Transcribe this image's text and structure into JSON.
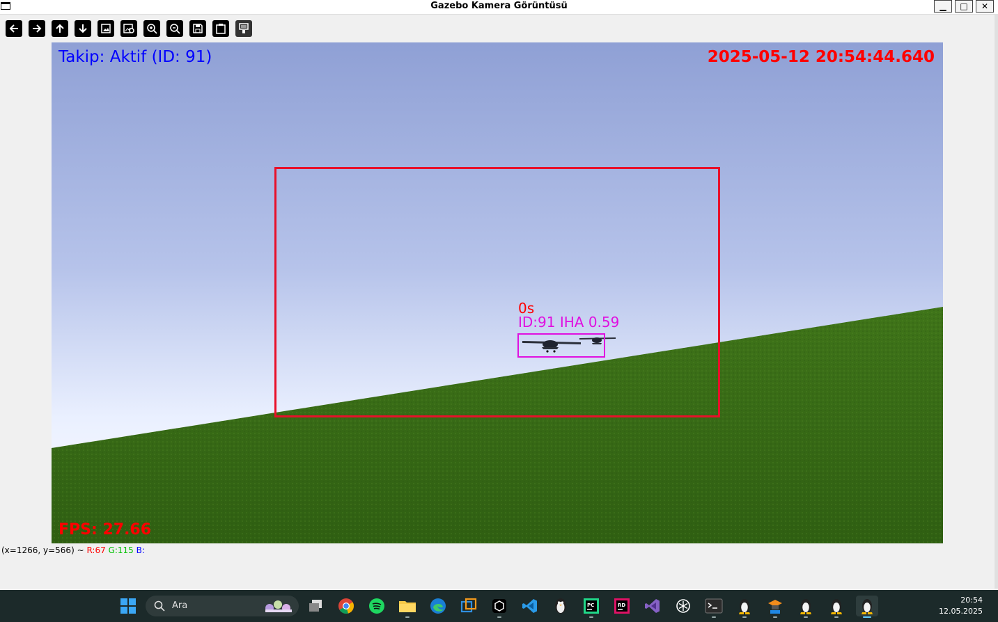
{
  "window": {
    "title": "Gazebo Kamera Görüntüsü"
  },
  "toolbar": {
    "buttons": [
      {
        "name": "pan-left-button",
        "icon": "arrow-left-icon"
      },
      {
        "name": "pan-right-button",
        "icon": "arrow-right-icon"
      },
      {
        "name": "pan-up-button",
        "icon": "arrow-up-icon"
      },
      {
        "name": "pan-down-button",
        "icon": "arrow-down-icon"
      },
      {
        "name": "zoom-fit-button",
        "icon": "image-icon"
      },
      {
        "name": "zoom-original-button",
        "icon": "image-zoom-icon"
      },
      {
        "name": "zoom-in-button",
        "icon": "zoom-in-icon"
      },
      {
        "name": "zoom-out-button",
        "icon": "zoom-out-icon"
      },
      {
        "name": "save-button",
        "icon": "save-icon"
      },
      {
        "name": "copy-button",
        "icon": "clipboard-icon"
      },
      {
        "name": "properties-button",
        "icon": "properties-icon"
      }
    ]
  },
  "overlay": {
    "tracking_status": "Takip: Aktif (ID: 91)",
    "timestamp": "2025-05-12 20:54:44.640",
    "fps": "FPS: 27.66",
    "detection_time": "0s",
    "detection_label": "ID:91 IHA 0.59"
  },
  "statusline": {
    "coords": "(x=1266, y=566) ~",
    "r": "R:67",
    "g": "G:115",
    "b": "B:"
  },
  "taskbar": {
    "search_placeholder": "Ara",
    "time": "20:54",
    "date": "12.05.2025"
  },
  "colors": {
    "sky_top": "#8ea0d6",
    "sky_horizon": "#f2f6ff",
    "grass": "#3a6d16",
    "tracking_text": "#0000ff",
    "timestamp_text": "#ff0000",
    "search_box": "#e8102a",
    "detection_box": "#e010e0"
  }
}
